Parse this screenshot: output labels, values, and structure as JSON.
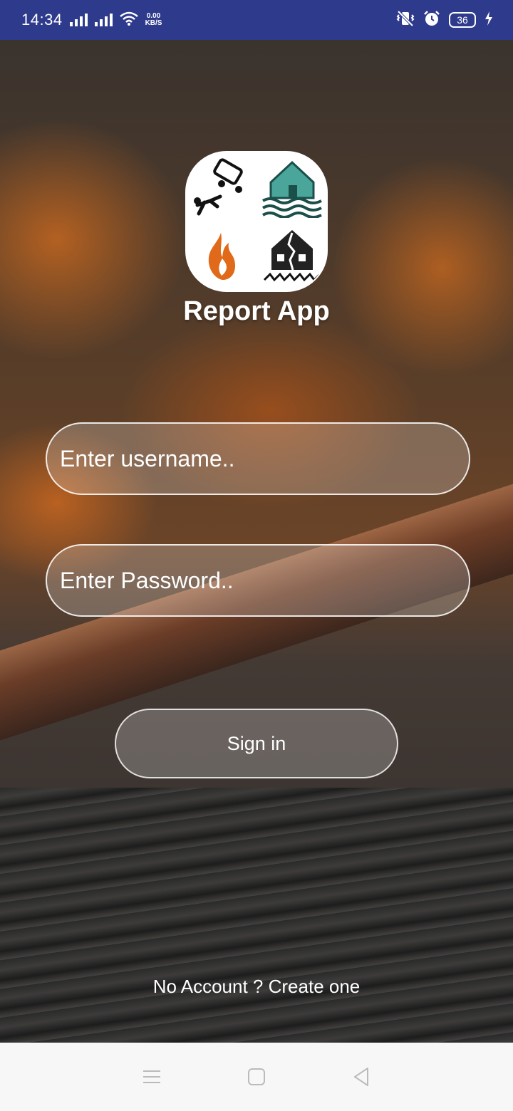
{
  "status_bar": {
    "time": "14:34",
    "net_speed_value": "0.00",
    "net_speed_unit": "KB/S",
    "battery": "36",
    "icons": [
      "signal-icon",
      "signal-icon",
      "wifi-icon",
      "vibrate-icon",
      "alarm-icon",
      "battery-icon",
      "charging-icon"
    ]
  },
  "app": {
    "title": "Report App",
    "logo_quadrants": [
      "accident-icon",
      "flood-icon",
      "fire-icon",
      "earthquake-icon"
    ]
  },
  "form": {
    "username_placeholder": "Enter username..",
    "password_placeholder": "Enter Password..",
    "signin_label": "Sign in",
    "create_account_link": "No Account ? Create one"
  },
  "nav_bar": {
    "buttons": [
      "menu-icon",
      "home-icon",
      "back-icon"
    ]
  },
  "colors": {
    "status_bar": "#2e3a8c",
    "nav_bar": "#f7f7f7",
    "accent_orange": "#e06a1a",
    "logo_teal": "#4aa59a"
  }
}
